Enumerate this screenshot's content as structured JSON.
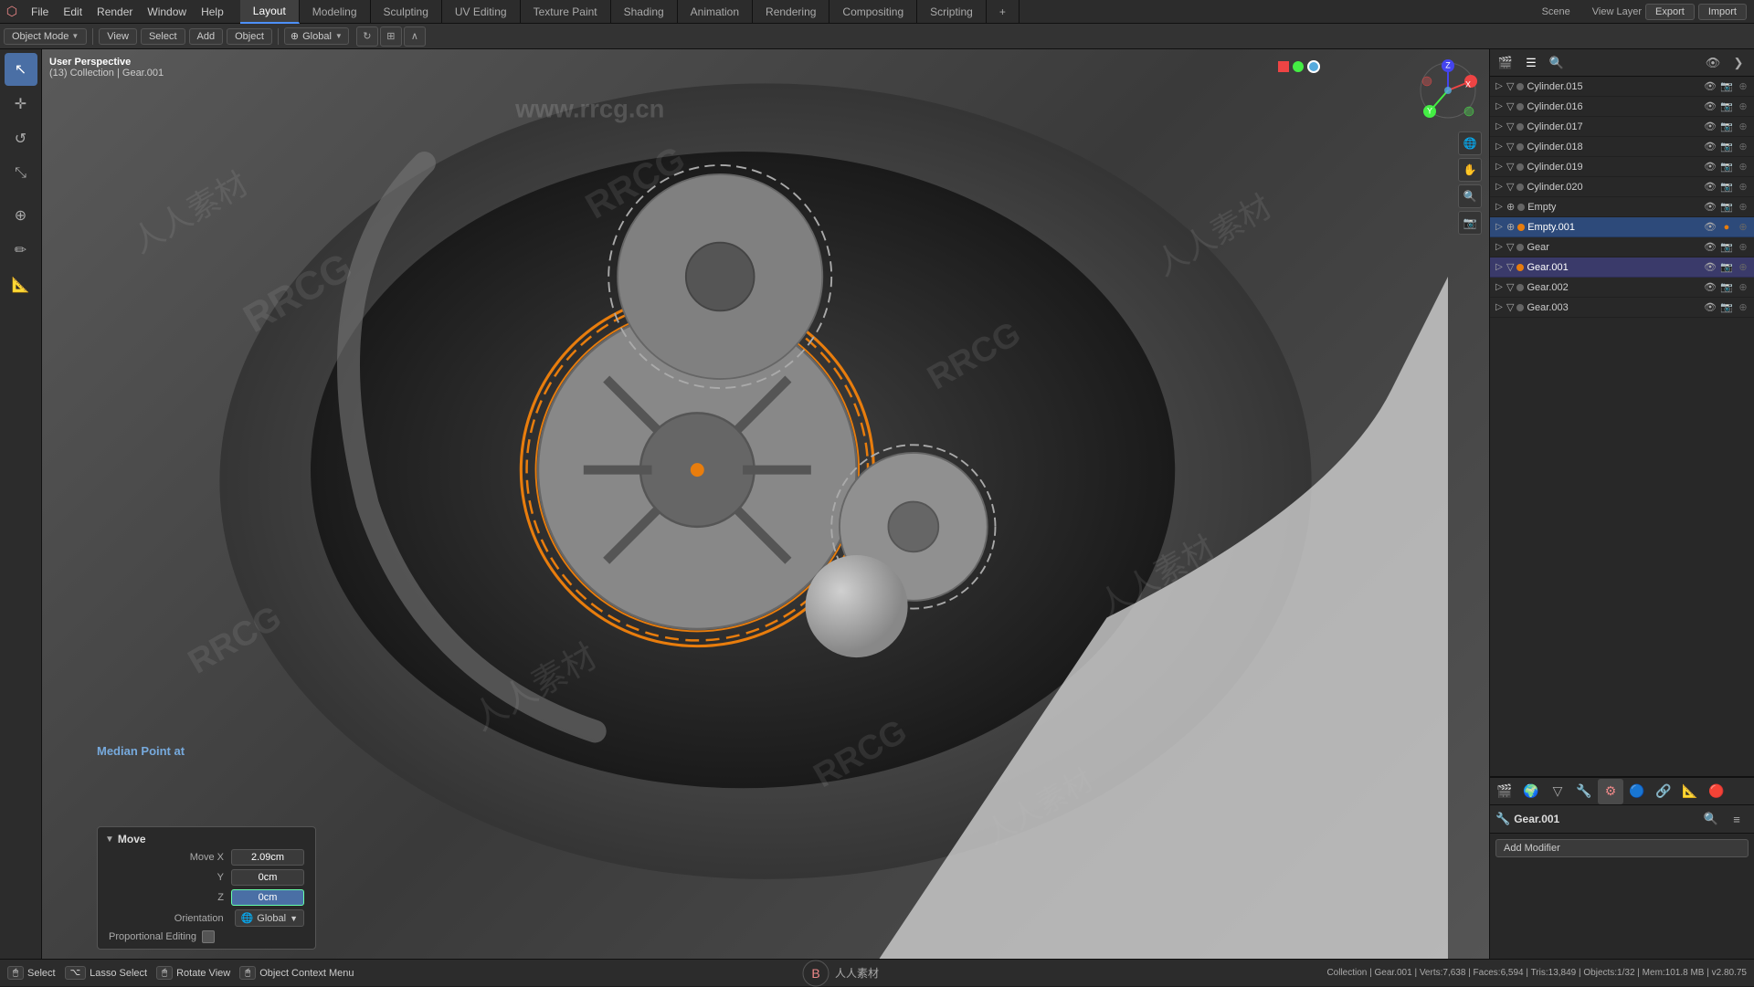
{
  "app": {
    "title": "Blender",
    "logo": "⬡"
  },
  "top_menu": {
    "items": [
      {
        "label": "File",
        "id": "file"
      },
      {
        "label": "Edit",
        "id": "edit"
      },
      {
        "label": "Render",
        "id": "render"
      },
      {
        "label": "Window",
        "id": "window"
      },
      {
        "label": "Help",
        "id": "help"
      }
    ]
  },
  "workspace_tabs": [
    {
      "label": "Layout",
      "active": true
    },
    {
      "label": "Modeling",
      "active": false
    },
    {
      "label": "Sculpting",
      "active": false
    },
    {
      "label": "UV Editing",
      "active": false
    },
    {
      "label": "Texture Paint",
      "active": false
    },
    {
      "label": "Shading",
      "active": false
    },
    {
      "label": "Animation",
      "active": false
    },
    {
      "label": "Rendering",
      "active": false
    },
    {
      "label": "Compositing",
      "active": false
    },
    {
      "label": "Scripting",
      "active": false
    }
  ],
  "top_right_btns": [
    {
      "label": "Export",
      "id": "export"
    },
    {
      "label": "Import",
      "id": "import"
    }
  ],
  "second_toolbar": {
    "mode": "Object Mode",
    "view": "View",
    "select": "Select",
    "add": "Add",
    "object": "Object",
    "global": "Global"
  },
  "viewport": {
    "perspective": "User Perspective",
    "collection": "(13) Collection | Gear.001"
  },
  "outliner": {
    "items": [
      {
        "name": "Cylinder.015",
        "level": 0,
        "type": "mesh",
        "color": "gray",
        "selected": false
      },
      {
        "name": "Cylinder.016",
        "level": 0,
        "type": "mesh",
        "color": "gray",
        "selected": false
      },
      {
        "name": "Cylinder.017",
        "level": 0,
        "type": "mesh",
        "color": "gray",
        "selected": false
      },
      {
        "name": "Cylinder.018",
        "level": 0,
        "type": "mesh",
        "color": "gray",
        "selected": false
      },
      {
        "name": "Cylinder.019",
        "level": 0,
        "type": "mesh",
        "color": "gray",
        "selected": false
      },
      {
        "name": "Cylinder.020",
        "level": 0,
        "type": "mesh",
        "color": "gray",
        "selected": false
      },
      {
        "name": "Empty",
        "level": 0,
        "type": "empty",
        "color": "gray",
        "selected": false
      },
      {
        "name": "Empty.001",
        "level": 0,
        "type": "empty",
        "color": "orange",
        "selected": true
      },
      {
        "name": "Gear",
        "level": 0,
        "type": "mesh",
        "color": "gray",
        "selected": false
      },
      {
        "name": "Gear.001",
        "level": 0,
        "type": "mesh",
        "color": "orange",
        "selected": false,
        "active": true
      },
      {
        "name": "Gear.002",
        "level": 0,
        "type": "mesh",
        "color": "gray",
        "selected": false
      },
      {
        "name": "Gear.003",
        "level": 0,
        "type": "mesh",
        "color": "gray",
        "selected": false
      }
    ]
  },
  "properties_panel": {
    "object_name": "Gear.001",
    "add_modifier_label": "Add Modifier",
    "icons": [
      "🔗",
      "📐",
      "⚙",
      "🔧",
      "🌀",
      "🌊",
      "🔵",
      "🔴",
      "⭐"
    ]
  },
  "move_panel": {
    "title": "Move",
    "move_x_label": "Move X",
    "move_x_value": "2.09cm",
    "y_label": "Y",
    "y_value": "0cm",
    "z_label": "Z",
    "z_value": "0cm",
    "orientation_label": "Orientation",
    "orientation_value": "Global",
    "proportional_editing_label": "Proportional Editing",
    "median_label": "Median Point at"
  },
  "status_bar": {
    "shortcuts": [
      {
        "key": "LMB",
        "label": "Select"
      },
      {
        "key": "⌥",
        "label": "Lasso Select"
      },
      {
        "key": "MMB",
        "label": "Rotate View"
      },
      {
        "key": "RMB",
        "label": "Object Context Menu"
      }
    ],
    "center_logo": "人人素材",
    "info": "Collection | Gear.001 | Verts:7,638 | Faces:6,594 | Tris:13,849 | Objects:1/32 | Mem:101.8 MB | v2.80.75"
  },
  "gizmo": {
    "x_label": "X",
    "y_label": "Y",
    "z_label": "Z"
  },
  "sidebar_tools": [
    {
      "icon": "↖",
      "name": "select-tool"
    },
    {
      "icon": "⊕",
      "name": "transform-tool"
    },
    {
      "icon": "↺",
      "name": "rotate-tool"
    },
    {
      "icon": "⤡",
      "name": "scale-tool"
    },
    {
      "icon": "✏",
      "name": "annotate-tool"
    },
    {
      "icon": "📐",
      "name": "measure-tool"
    }
  ],
  "right_panel_icons": [
    {
      "icon": "🔍",
      "name": "filter-icon"
    },
    {
      "icon": "☰",
      "name": "list-icon"
    }
  ]
}
